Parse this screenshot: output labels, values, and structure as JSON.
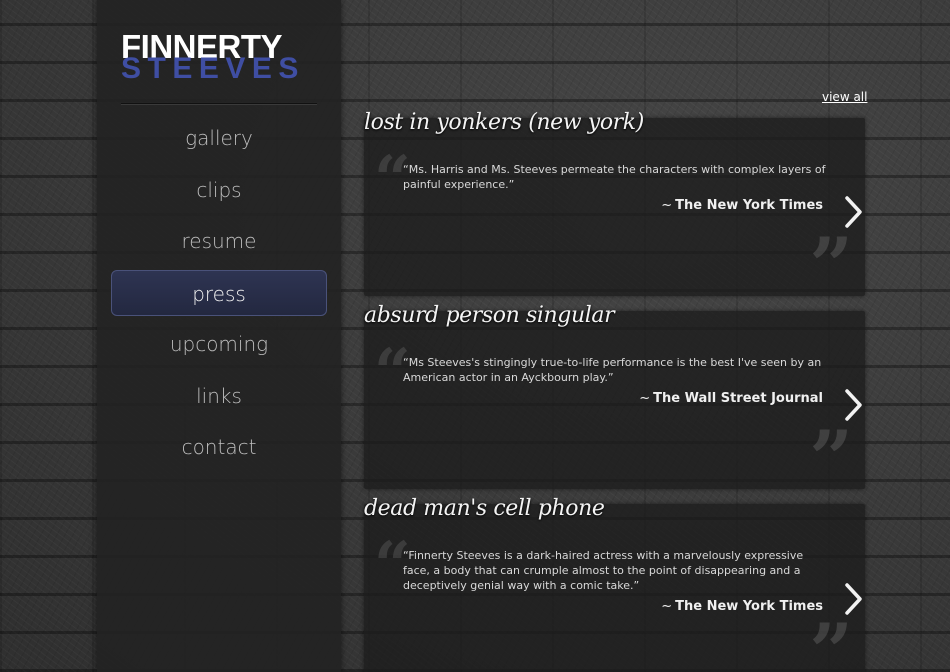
{
  "logo": {
    "line1": "FINNERTY",
    "line2": "STEEVES"
  },
  "nav": {
    "items": [
      {
        "label": "gallery"
      },
      {
        "label": "clips"
      },
      {
        "label": "resume"
      },
      {
        "label": "press",
        "active": true
      },
      {
        "label": "upcoming"
      },
      {
        "label": "links"
      },
      {
        "label": "contact"
      }
    ]
  },
  "press": {
    "view_all_label": "view all",
    "items": [
      {
        "title": "lost in yonkers (new york)",
        "quote": "“Ms. Harris and Ms. Steeves permeate the characters with complex layers of painful experience.”",
        "source": "The New York Times"
      },
      {
        "title": "absurd person singular",
        "quote": "“Ms Steeves's stingingly true-to-life performance is the best I've seen by an American actor in an Ayckbourn play.”",
        "source": "The Wall Street Journal"
      },
      {
        "title": "dead man's cell phone",
        "quote": "“Finnerty Steeves is a dark-haired actress with a marvelously expressive face, a body that can crumple almost to the point of disappearing and a deceptively genial way with a comic take.”",
        "source": "The New York Times"
      }
    ]
  },
  "colors": {
    "logo_accent": "#3f4ea3",
    "active_nav": "#2b304b"
  }
}
